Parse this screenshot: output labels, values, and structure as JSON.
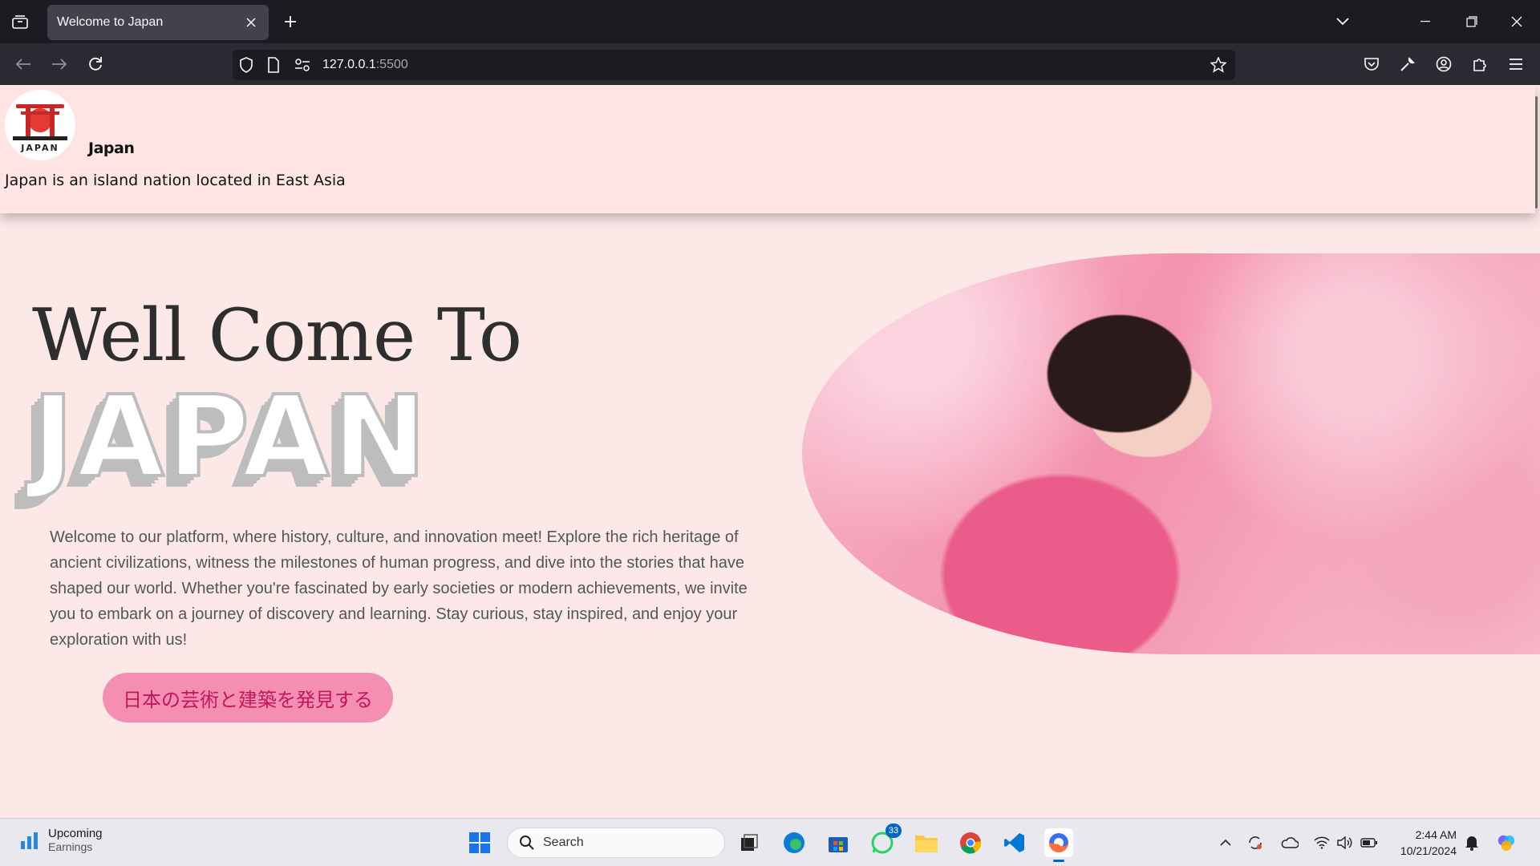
{
  "browser": {
    "tab_title": "Welcome to Japan",
    "url_host": "127.0.0.1",
    "url_port": ":5500"
  },
  "site": {
    "logo_text": "JAPAN",
    "brand": "Japan",
    "tagline": "Japan is an island nation located in East Asia",
    "hero_line1": "Well Come To",
    "hero_line2": "JAPAN",
    "intro": "Welcome to our platform, where history, culture, and innovation meet! Explore the rich heritage of ancient civilizations, witness the milestones of human progress, and dive into the stories that have shaped our world. Whether you're fascinated by early societies or modern achievements, we invite you to embark on a journey of discovery and learning. Stay curious, stay inspired, and enjoy your exploration with us!",
    "cta": "日本の芸術と建築を発見する"
  },
  "taskbar": {
    "widget_title": "Upcoming",
    "widget_sub": "Earnings",
    "search_label": "Search",
    "whatsapp_badge": "33",
    "time": "2:44 AM",
    "date": "10/21/2024"
  },
  "colors": {
    "page_bg": "#fde8e8",
    "header_bg": "#ffe4e4",
    "cta_bg": "#f48fb1",
    "cta_text": "#c2185b"
  }
}
